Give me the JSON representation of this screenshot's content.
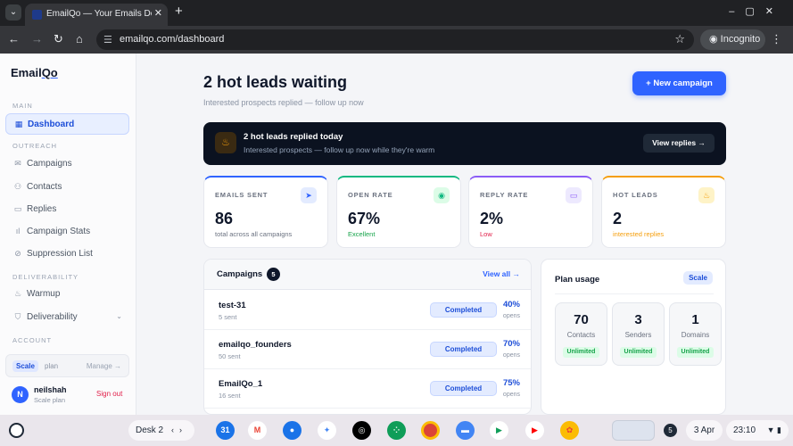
{
  "browser": {
    "tab_title": "EmailQo — Your Emails Deserve",
    "url": "emailqo.com/dashboard",
    "incognito_label": "Incognito"
  },
  "sidebar": {
    "logo": "EmailQo",
    "section_main": "MAIN",
    "section_outreach": "OUTREACH",
    "section_deliverability": "DELIVERABILITY",
    "section_account": "ACCOUNT",
    "items": [
      {
        "label": "Dashboard",
        "icon": "grid-icon",
        "active": true
      },
      {
        "label": "Campaigns",
        "icon": "mail-icon"
      },
      {
        "label": "Contacts",
        "icon": "users-icon"
      },
      {
        "label": "Replies",
        "icon": "message-icon"
      },
      {
        "label": "Campaign Stats",
        "icon": "bar-chart-icon"
      },
      {
        "label": "Suppression List",
        "icon": "block-icon"
      },
      {
        "label": "Warmup",
        "icon": "flame-icon"
      },
      {
        "label": "Deliverability",
        "icon": "shield-icon"
      }
    ],
    "plan_chip": "Scale",
    "plan_word": "plan",
    "plan_manage": "Manage →",
    "user_initial": "N",
    "user_name": "neilshah",
    "user_plan": "Scale plan",
    "sign_out": "Sign out"
  },
  "main": {
    "title": "2 hot leads waiting",
    "subtitle": "Interested prospects replied — follow up now",
    "new_campaign": "+ New campaign",
    "banner": {
      "title": "2 hot leads replied today",
      "subtitle": "Interested prospects — follow up now while they're warm",
      "button": "View replies →"
    },
    "stats": [
      {
        "label": "EMAILS SENT",
        "value": "86",
        "note": "total across all campaigns",
        "icon": "send-icon",
        "accent": "#2f63ff",
        "note_color": "#6b7280"
      },
      {
        "label": "OPEN RATE",
        "value": "67%",
        "note": "Excellent",
        "icon": "eye-icon",
        "accent": "#10b981",
        "note_color": "#16a34a"
      },
      {
        "label": "REPLY RATE",
        "value": "2%",
        "note": "Low",
        "icon": "chat-icon",
        "accent": "#8b5cf6",
        "note_color": "#e11d48"
      },
      {
        "label": "HOT LEADS",
        "value": "2",
        "note": "interested replies",
        "icon": "flame-icon",
        "accent": "#f59e0b",
        "note_color": "#f59e0b"
      }
    ],
    "campaigns": {
      "title": "Campaigns",
      "count": "5",
      "view_all": "View all →",
      "rows": [
        {
          "name": "test-31",
          "sent": "5 sent",
          "status": "Completed",
          "rate": "40%",
          "rate_label": "opens"
        },
        {
          "name": "emailqo_founders",
          "sent": "50 sent",
          "status": "Completed",
          "rate": "70%",
          "rate_label": "opens"
        },
        {
          "name": "EmailQo_1",
          "sent": "16 sent",
          "status": "Completed",
          "rate": "75%",
          "rate_label": "opens"
        }
      ]
    },
    "plan_usage": {
      "title": "Plan usage",
      "badge": "Scale",
      "items": [
        {
          "value": "70",
          "label": "Contacts",
          "limit": "Unlimited"
        },
        {
          "value": "3",
          "label": "Senders",
          "limit": "Unlimited"
        },
        {
          "value": "1",
          "label": "Domains",
          "limit": "Unlimited"
        }
      ]
    }
  },
  "shelf": {
    "desk": "Desk 2",
    "notifications": "5",
    "date": "3 Apr",
    "time": "23:10"
  }
}
